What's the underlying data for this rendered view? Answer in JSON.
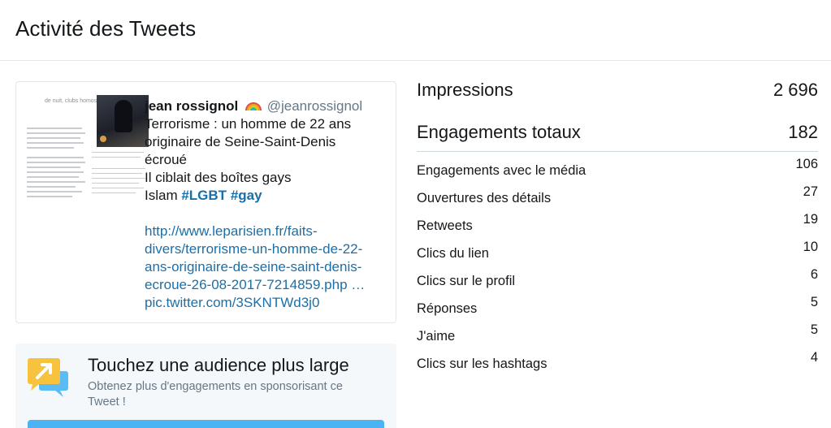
{
  "page": {
    "title": "Activité des Tweets"
  },
  "tweet": {
    "author_name": "jean rossignol",
    "handle": "@jeanrossignol",
    "text_lines": [
      "Terrorisme : un homme de 22 ans",
      "originaire de Seine-Saint-Denis",
      "écroué",
      "Il ciblait des boîtes gays"
    ],
    "last_line_prefix": "Islam ",
    "hashtag_1": "#LGBT",
    "hashtag_2": "#gay",
    "link_lines": [
      "http://www.leparisien.fr/faits-",
      "divers/terrorisme-un-homme-de-22-",
      "ans-originaire-de-seine-saint-denis-",
      "ecroue-26-08-2017-7214859.php …"
    ],
    "pic_link": "pic.twitter.com/3SKNTWd3j0",
    "thumb_caption": "de nuit, clubs homosexuels"
  },
  "promo": {
    "title": "Touchez une audience plus large",
    "subtitle": "Obtenez plus d'engagements en sponsorisant ce Tweet !"
  },
  "stats": {
    "impressions_label": "Impressions",
    "impressions_value": "2 696",
    "engagements_label": "Engagements totaux",
    "engagements_value": "182",
    "rows": [
      {
        "label": "Engagements avec le média",
        "value": "106"
      },
      {
        "label": "Ouvertures des détails",
        "value": "27"
      },
      {
        "label": "Retweets",
        "value": "19"
      },
      {
        "label": "Clics du lien",
        "value": "10"
      },
      {
        "label": "Clics sur le profil",
        "value": "6"
      },
      {
        "label": "Réponses",
        "value": "5"
      },
      {
        "label": "J'aime",
        "value": "5"
      },
      {
        "label": "Clics sur les hashtags",
        "value": "4"
      }
    ]
  },
  "colors": {
    "link": "#1b6fa8",
    "promo_button": "#4ab3f4",
    "promo_bg": "#f5f8fa"
  }
}
